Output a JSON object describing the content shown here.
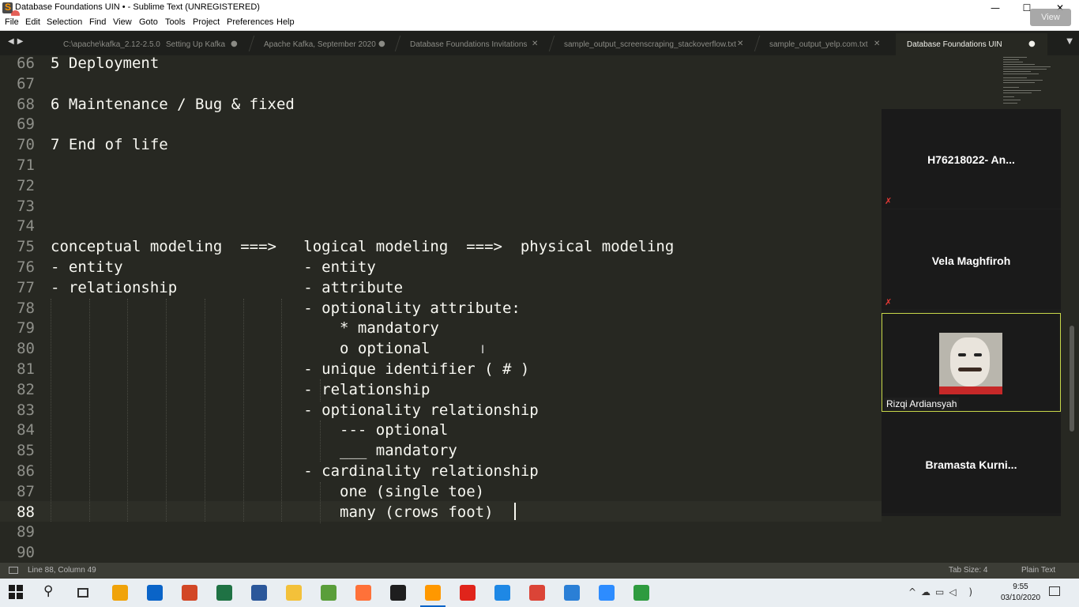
{
  "window": {
    "title": "Database Foundations UIN • - Sublime Text (UNREGISTERED)",
    "controls": {
      "minimize": "—",
      "maximize": "☐",
      "close": "✕"
    }
  },
  "menu": [
    "File",
    "Edit",
    "Selection",
    "Find",
    "View",
    "Goto",
    "Tools",
    "Project",
    "Preferences",
    "Help"
  ],
  "view_button": "View",
  "tabs": [
    {
      "label": "C:\\apache\\kafka_2.12-2.5.0"
    },
    {
      "label": "Setting Up Kafka",
      "close": "●"
    },
    {
      "label": "Apache Kafka, September 2020",
      "close": "●"
    },
    {
      "label": "Database Foundations Invitations",
      "close": "✕"
    },
    {
      "label": "sample_output_screenscraping_stackoverflow.txt",
      "close": "✕"
    },
    {
      "label": "sample_output_yelp.com.txt",
      "close": "✕"
    },
    {
      "label": "Database Foundations UIN",
      "close": "●",
      "active": true
    }
  ],
  "editor": {
    "lines": [
      {
        "n": "66",
        "text": "5 Deployment"
      },
      {
        "n": "67",
        "text": ""
      },
      {
        "n": "68",
        "text": "6 Maintenance / Bug & fixed"
      },
      {
        "n": "69",
        "text": ""
      },
      {
        "n": "70",
        "text": "7 End of life"
      },
      {
        "n": "71",
        "text": ""
      },
      {
        "n": "72",
        "text": ""
      },
      {
        "n": "73",
        "text": ""
      },
      {
        "n": "74",
        "text": ""
      },
      {
        "n": "75",
        "text": "conceptual modeling  ===>   logical modeling  ===>  physical modeling"
      },
      {
        "n": "76",
        "text": "- entity                    - entity"
      },
      {
        "n": "77",
        "text": "- relationship              - attribute"
      },
      {
        "n": "78",
        "text": "                            - optionality attribute:"
      },
      {
        "n": "79",
        "text": "                                * mandatory"
      },
      {
        "n": "80",
        "text": "                                o optional"
      },
      {
        "n": "81",
        "text": "                            - unique identifier ( # )"
      },
      {
        "n": "82",
        "text": "                            - relationship"
      },
      {
        "n": "83",
        "text": "                            - optionality relationship"
      },
      {
        "n": "84",
        "text": "                                --- optional"
      },
      {
        "n": "85",
        "text": "                                ___ mandatory"
      },
      {
        "n": "86",
        "text": "                            - cardinality relationship"
      },
      {
        "n": "87",
        "text": "                                one (single toe)"
      },
      {
        "n": "88",
        "text": "                                many (crows foot)",
        "current": true
      },
      {
        "n": "89",
        "text": ""
      },
      {
        "n": "90",
        "text": ""
      }
    ]
  },
  "zoom": {
    "participants": [
      {
        "name": "H76218022- An...",
        "muted_icon": "mic-muted-icon"
      },
      {
        "name": "Vela Maghfiroh",
        "muted_icon": "mic-muted-icon"
      },
      {
        "name": "Rizqi Ardiansyah",
        "video": true
      },
      {
        "name": "Bramasta Kurni..."
      }
    ]
  },
  "status": {
    "position": "Line 88, Column 49",
    "tab_size": "Tab Size: 4",
    "syntax": "Plain Text"
  },
  "taskbar": {
    "apps": [
      {
        "icon": "store-icon",
        "color": "#f0a30a"
      },
      {
        "icon": "mail-icon",
        "color": "#0a64c8"
      },
      {
        "icon": "powerpoint-icon",
        "color": "#d24726"
      },
      {
        "icon": "excel-icon",
        "color": "#1f7244"
      },
      {
        "icon": "word-icon",
        "color": "#2b579a"
      },
      {
        "icon": "file-explorer-icon",
        "color": "#f3c13a"
      },
      {
        "icon": "image-app-icon",
        "color": "#5a9e3a"
      },
      {
        "icon": "firefox-icon",
        "color": "#ff7139"
      },
      {
        "icon": "terminal-icon",
        "color": "#1e1e1e"
      },
      {
        "icon": "sublime-text-icon",
        "color": "#ff9800",
        "active": true
      },
      {
        "icon": "acrobat-icon",
        "color": "#e0241b"
      },
      {
        "icon": "edge-icon",
        "color": "#1e88e5"
      },
      {
        "icon": "chrome-icon",
        "color": "#db4437"
      },
      {
        "icon": "remote-desktop-icon",
        "color": "#2a7fd6"
      },
      {
        "icon": "zoom-icon",
        "color": "#2d8cff"
      },
      {
        "icon": "green-app-icon",
        "color": "#2e9b3f"
      }
    ],
    "time": "9:55",
    "date": "03/10/2020"
  }
}
